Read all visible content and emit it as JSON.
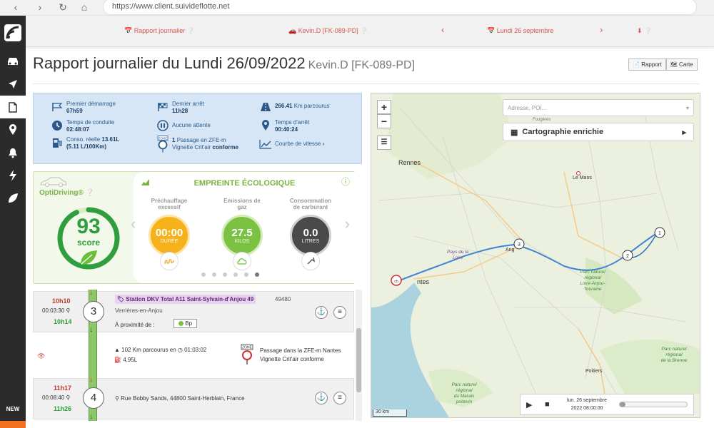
{
  "browser": {
    "url": "https://www.client.suivideflotte.net"
  },
  "sidebar": {
    "new_label": "NEW"
  },
  "topnav": {
    "report": "Rapport journalier",
    "driver": "Kevin.D [FK-089-PD]",
    "date": "Lundi 26 septembre"
  },
  "header": {
    "title": "Rapport journalier du Lundi 26/09/2022",
    "subtitle": "Kevin.D [FK-089-PD]",
    "report_btn": "Rapport",
    "map_btn": "Carte"
  },
  "stats": {
    "first_start_label": "Premier démarrage",
    "first_start_value": "07h59",
    "last_stop_label": "Dernier arrêt",
    "last_stop_value": "11h28",
    "distance_value": "266.41",
    "distance_label": "Km parcourus",
    "drive_time_label": "Temps de conduite",
    "drive_time_value": "02:48:07",
    "waiting_label": "Aucune attente",
    "stop_time_label": "Temps d'arrêt",
    "stop_time_value": "00:40:24",
    "consumption_label": "Conso. réelle",
    "consumption_value": "13.61L",
    "consumption_avg": "(5.11 L/100Km)",
    "zfe_count": "1",
    "zfe_text": "Passage en ZFE-m",
    "zfe_text2": "Vignette Crit'air",
    "zfe_status": "conforme",
    "zone_label": "ZONE",
    "speed_curve": "Courbe de vitesse"
  },
  "eco": {
    "brand": "OptiDriving®",
    "score": "93",
    "score_label": "score",
    "title": "EMPREINTE ÉCOLOGIQUE",
    "preheat_label_1": "Préchauffage",
    "preheat_label_2": "excessif",
    "preheat_value": "00:00",
    "preheat_unit": "DURÉE",
    "emissions_label_1": "Emissions de",
    "emissions_label_2": "gaz",
    "emissions_value": "27.5",
    "emissions_unit": "KILOS",
    "fuel_label_1": "Consommation",
    "fuel_label_2": "de carburant",
    "fuel_value": "0.0",
    "fuel_unit": "LITRES",
    "score_fraction": 0.93,
    "colors": {
      "preheat": "#f5b21a",
      "emissions": "#7cc242",
      "fuel": "#4a4a4a"
    }
  },
  "timeline": {
    "stop3": {
      "number": "3",
      "arrive": "10h10",
      "duration": "00:03:30",
      "depart": "10h14",
      "name": "Station DKV Total A11 Saint-Sylvain-d'Anjou 49",
      "postcode": "49480",
      "city": "Verrières-en-Anjou",
      "nearby_label": "À proximité de :",
      "nearby_value": "Bp"
    },
    "leg": {
      "distance": "102 Km parcourus en",
      "duration": "01:03:02",
      "fuel": "4.95L",
      "zfe_line1": "Passage dans la ZFE-m Nantes",
      "zfe_line2": "Vignette Crit'air conforme",
      "zone_label": "ZONE"
    },
    "stop4": {
      "number": "4",
      "arrive": "11h17",
      "duration": "00:08:40",
      "depart": "11h26",
      "address": "Rue Bobby Sands, 44800 Saint-Herblain, France"
    }
  },
  "map": {
    "search_placeholder": "Adresse, POI...",
    "enrich_label": "Cartographie enrichie",
    "player_date": "lun. 26 septembre",
    "player_time": "2022 08:00:00",
    "scale": "30 km",
    "places": {
      "rennes": "Rennes",
      "le_mans": "Le Mans",
      "nantes": "ntes",
      "angers": "Ang",
      "tours": "Tours",
      "poitiers": "Poitiers",
      "pays_loire_1": "Pays de la",
      "pays_loire_2": "Loire",
      "parc_loire_1": "Parc naturel",
      "parc_loire_2": "régional",
      "parc_loire_3": "Loire-Anjou-",
      "parc_loire_4": "Touraine",
      "parc_brenne_1": "Parc naturel",
      "parc_brenne_2": "régional",
      "parc_brenne_3": "de la Brenne",
      "parc_marais_1": "Parc naturel",
      "parc_marais_2": "régional",
      "parc_marais_3": "du Marais",
      "parc_marais_4": "poitevin",
      "rennes_label_north": "Fougères",
      "marker_1": "1",
      "marker_2": "2",
      "marker_3": "3",
      "start_marker": "ch"
    }
  }
}
